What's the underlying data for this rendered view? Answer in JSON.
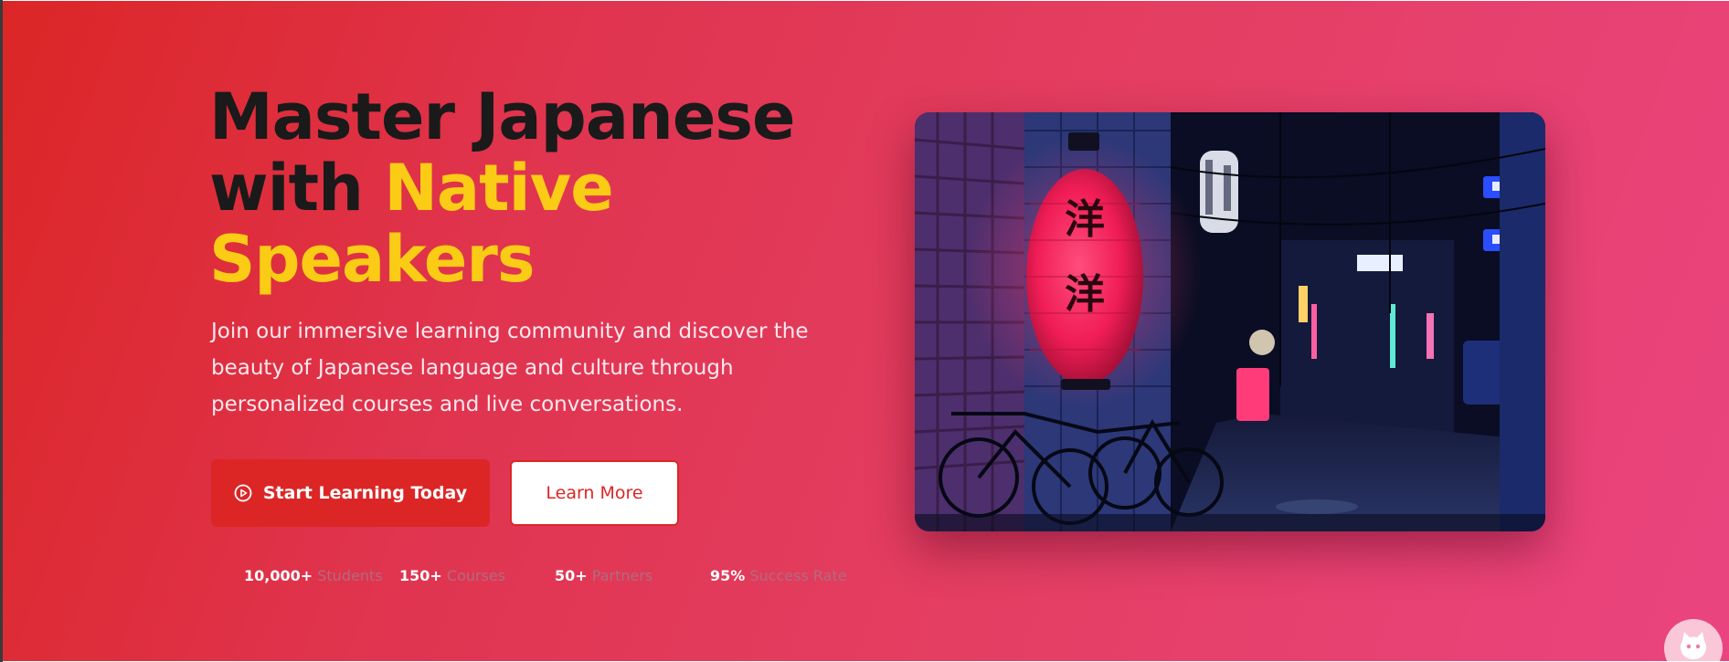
{
  "hero": {
    "headline_line1": "Master Japanese",
    "headline_with": "with ",
    "headline_accent1": "Native",
    "headline_accent2": "Speakers",
    "subtext": "Join our immersive learning community and discover the beauty of Japanese language and culture through personalized courses and live conversations.",
    "primary_button": "Start Learning Today",
    "primary_icon": "play-circle-icon",
    "secondary_button": "Learn More",
    "image_alt_lantern_text": "洋洋"
  },
  "stats": [
    {
      "value": "10,000+",
      "label": "Students"
    },
    {
      "value": "150+",
      "label": "Courses"
    },
    {
      "value": "50+",
      "label": "Partners"
    },
    {
      "value": "95%",
      "label": "Success Rate"
    }
  ],
  "floating_button": {
    "icon": "github-octocat-icon"
  },
  "colors": {
    "gradient_start": "#dc2626",
    "gradient_end": "#ea4480",
    "accent_yellow": "#facc15",
    "primary_red": "#dc2626",
    "headline_dark": "#1a1a1a"
  }
}
